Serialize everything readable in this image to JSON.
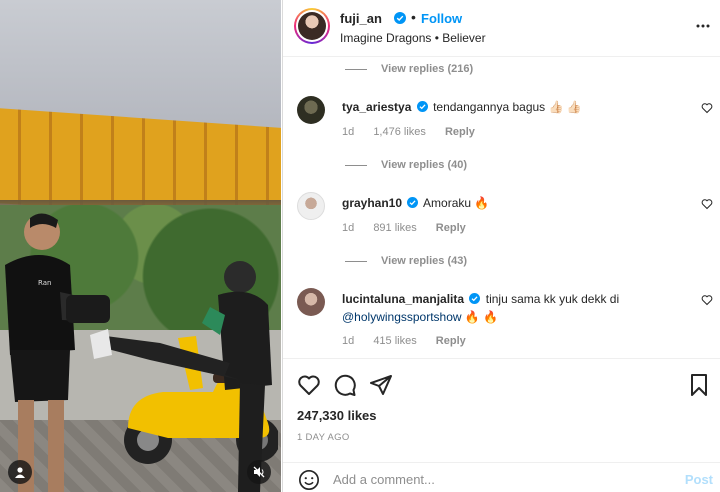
{
  "header": {
    "username": "fuji_an",
    "follow_label": "Follow",
    "audio": "Imagine Dragons • Believer",
    "separator": "•"
  },
  "comments": {
    "view_replies_1": "View replies (216)",
    "view_replies_2": "View replies (40)",
    "view_replies_3": "View replies (43)",
    "items": [
      {
        "username": "tya_ariestya",
        "text": "tendangannya bagus",
        "emoji": "👍🏻 👍🏻",
        "age": "1d",
        "likes": "1,476 likes",
        "reply": "Reply"
      },
      {
        "username": "grayhan10",
        "text": "Amoraku",
        "emoji": "🔥",
        "age": "1d",
        "likes": "891 likes",
        "reply": "Reply"
      },
      {
        "username": "lucintaluna_manjalita",
        "text": "tinju sama kk yuk dekk di",
        "mention": "@holywingssportshow",
        "emoji": "🔥 🔥",
        "age": "1d",
        "likes": "415 likes",
        "reply": "Reply"
      }
    ]
  },
  "actions": {
    "likes": "247,330 likes",
    "date": "1 DAY AGO"
  },
  "composer": {
    "placeholder": "Add a comment...",
    "post_label": "Post"
  },
  "icons": {
    "verified": "verified-badge-icon",
    "more": "more-options-icon",
    "heart": "heart-icon",
    "comment": "comment-icon",
    "share": "share-icon",
    "save": "bookmark-icon",
    "emoji": "emoji-icon",
    "user": "user-icon",
    "mute": "mute-icon"
  },
  "colors": {
    "link_blue": "#0095f6",
    "post_disabled": "#b2dffc",
    "mention": "#00376b",
    "muted_text": "#8e8e8e"
  }
}
